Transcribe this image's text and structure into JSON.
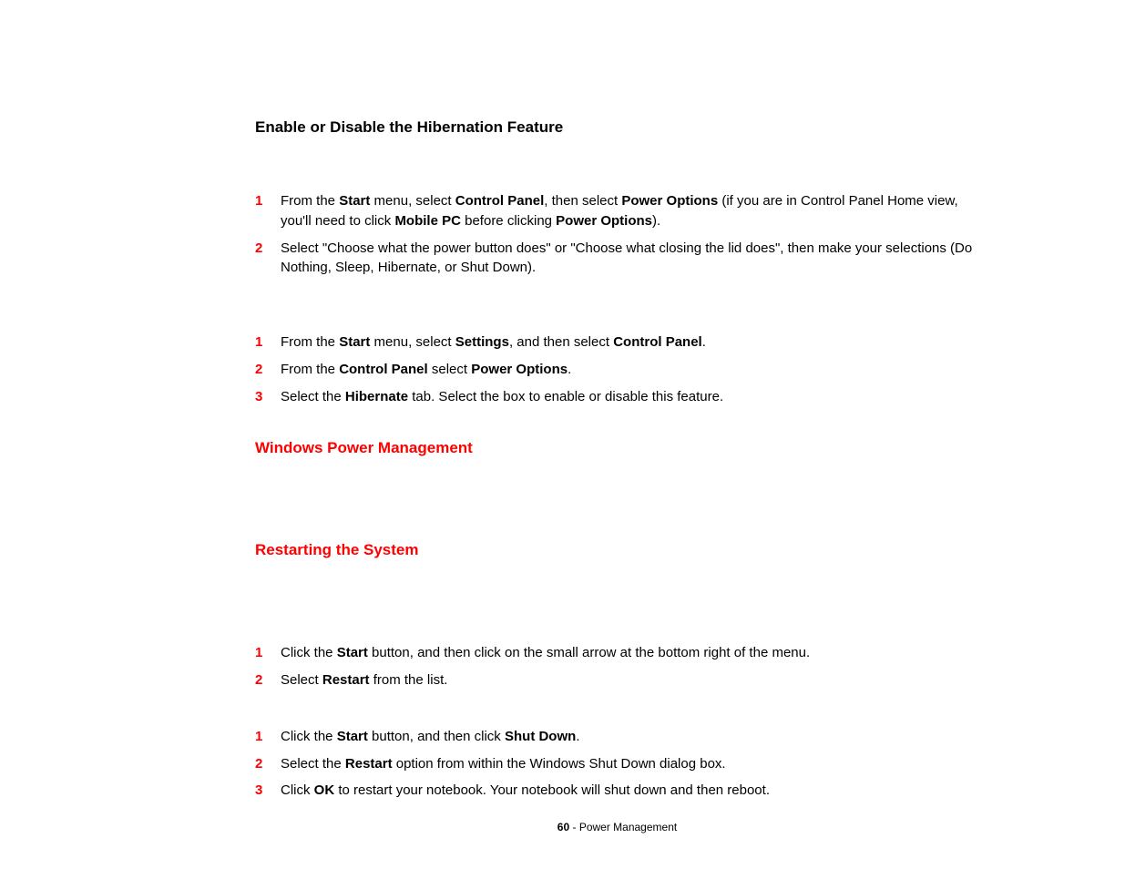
{
  "heading_main": "Enable or Disable the Hibernation Feature",
  "list1": {
    "n1": "1",
    "t1": "From the <strong>Start</strong> menu, select <strong>Control Panel</strong>, then select <strong>Power Options</strong> (if you are in Control Panel Home view, you'll need to click <strong>Mobile PC</strong> before clicking <strong>Power Options</strong>).",
    "n2": "2",
    "t2": "Select \"Choose what the power button does\" or \"Choose what closing the lid does\", then make your selections (Do Nothing, Sleep, Hibernate, or Shut Down)."
  },
  "list2": {
    "n1": "1",
    "t1": "From the <strong>Start</strong> menu, select <strong>Settings</strong>, and then select <strong>Control Panel</strong>.",
    "n2": "2",
    "t2": "From the <strong>Control Panel</strong> select <strong>Power Options</strong>.",
    "n3": "3",
    "t3": "Select the <strong>Hibernate</strong> tab. Select the box to enable or disable this feature."
  },
  "heading_wpm": "Windows Power Management",
  "heading_restart": "Restarting the System",
  "list3": {
    "n1": "1",
    "t1": "Click the <strong>Start</strong> button, and then click on the small arrow at the bottom right of the menu.",
    "n2": "2",
    "t2": "Select <strong>Restart</strong> from the list."
  },
  "list4": {
    "n1": "1",
    "t1": "Click the <strong>Start</strong> button, and then click <strong>Shut Down</strong>.",
    "n2": "2",
    "t2": "Select the <strong>Restart</strong> option from within the Windows Shut Down dialog box.",
    "n3": "3",
    "t3": "Click <strong>OK</strong> to restart your notebook. Your notebook will shut down and then reboot."
  },
  "footer_page": "60",
  "footer_sep": " - ",
  "footer_title": "Power Management"
}
